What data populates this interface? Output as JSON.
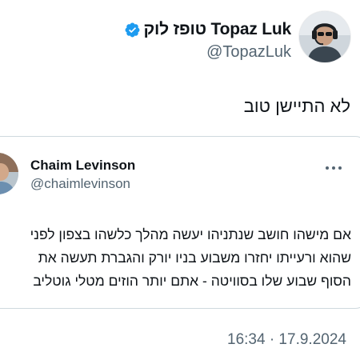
{
  "author": {
    "display_name": "טופז לוק Topaz Luk",
    "handle": "@TopazLuk",
    "verified": true
  },
  "tweet": {
    "text": "לא התיישן טוב",
    "timestamp": "16:34 · 17.9.2024"
  },
  "quoted_tweet": {
    "author_name": "Chaim Levinson",
    "author_handle": "@chaimlevinson",
    "lines": [
      "אם מישהו חושב שנתניהו יעשה מהלך כלשהו בצפון לפני",
      "שהוא ורעייתו יחזרו משבוע בניו יורק והגברת תעשה את",
      "הסוף שבוע שלו בסוויטה - אתם יותר הוזים מטלי גוטליב"
    ]
  },
  "icons": {
    "verified": "verified-badge-icon",
    "more": "more-options-icon"
  },
  "colors": {
    "primary_text": "#0f1419",
    "secondary_text": "#536471",
    "verified_blue": "#1d9bf0",
    "border": "#cfd9de"
  }
}
